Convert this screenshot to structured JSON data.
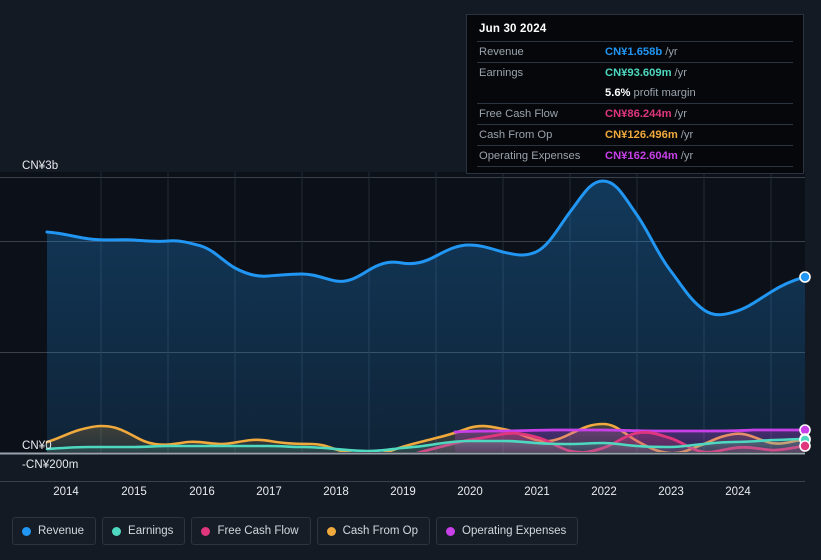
{
  "background": "#131a24",
  "axis": {
    "y_top_label": "CN¥3b",
    "y_zero_label": "CN¥0",
    "y_bottom_label": "-CN¥200m",
    "x_ticks": [
      "2014",
      "2015",
      "2016",
      "2017",
      "2018",
      "2019",
      "2020",
      "2021",
      "2022",
      "2023",
      "2024"
    ]
  },
  "tooltip": {
    "date": "Jun 30 2024",
    "rows": [
      {
        "label": "Revenue",
        "value": "CN¥1.658b",
        "unit": "/yr",
        "color": "#2196f3"
      },
      {
        "label": "Earnings",
        "value": "CN¥93.609m",
        "unit": "/yr",
        "color": "#4fd8c0"
      },
      {
        "label": "",
        "value": "5.6%",
        "sub": "profit margin",
        "color": "#ffffff"
      },
      {
        "label": "Free Cash Flow",
        "value": "CN¥86.244m",
        "unit": "/yr",
        "color": "#e0367e"
      },
      {
        "label": "Cash From Op",
        "value": "CN¥126.496m",
        "unit": "/yr",
        "color": "#f0a93c"
      },
      {
        "label": "Operating Expenses",
        "value": "CN¥162.604m",
        "unit": "/yr",
        "color": "#c740e8"
      }
    ]
  },
  "legend": [
    {
      "label": "Revenue",
      "color": "#2196f3"
    },
    {
      "label": "Earnings",
      "color": "#4fd8c0"
    },
    {
      "label": "Free Cash Flow",
      "color": "#e0367e"
    },
    {
      "label": "Cash From Op",
      "color": "#f0a93c"
    },
    {
      "label": "Operating Expenses",
      "color": "#c740e8"
    }
  ],
  "chart_data": {
    "type": "area",
    "title": "",
    "xlabel": "",
    "ylabel": "",
    "ylim": [
      -200000000,
      3000000000
    ],
    "y_gridlines": [
      "CN¥3b",
      "CN¥2b",
      "CN¥1b",
      "CN¥0",
      "-CN¥200m"
    ],
    "grid": true,
    "legend_position": "bottom",
    "currency": "CN¥",
    "x_range": [
      "2013-06",
      "2024-06"
    ],
    "x": [
      2013.5,
      2014.0,
      2014.5,
      2015.0,
      2015.5,
      2016.0,
      2016.5,
      2017.0,
      2017.5,
      2018.0,
      2018.5,
      2019.0,
      2019.5,
      2020.0,
      2020.5,
      2021.0,
      2021.5,
      2022.0,
      2022.5,
      2023.0,
      2023.5,
      2024.0,
      2024.5
    ],
    "series": [
      {
        "name": "Revenue",
        "color": "#2196f3",
        "values": [
          2070,
          2010,
          1990,
          2000,
          1980,
          1960,
          1860,
          1790,
          1800,
          1790,
          1700,
          1740,
          1830,
          1820,
          1930,
          2300,
          2830,
          2560,
          2080,
          1690,
          1520,
          1620,
          1658
        ],
        "units": "CN¥ millions",
        "end_value_label": "CN¥1.658b"
      },
      {
        "name": "Earnings",
        "color": "#4fd8c0",
        "values": [
          40,
          42,
          45,
          48,
          46,
          44,
          42,
          43,
          45,
          44,
          38,
          30,
          44,
          58,
          66,
          78,
          82,
          60,
          52,
          64,
          78,
          88,
          93.609
        ],
        "units": "CN¥ millions",
        "end_value_label": "CN¥93.609m"
      },
      {
        "name": "Free Cash Flow",
        "color": "#e0367e",
        "values": [
          null,
          null,
          null,
          null,
          null,
          null,
          null,
          null,
          null,
          null,
          null,
          -120,
          -60,
          10,
          70,
          110,
          118,
          10,
          -40,
          70,
          130,
          30,
          86.244
        ],
        "units": "CN¥ millions",
        "end_value_label": "CN¥86.244m",
        "starts_at": "2019"
      },
      {
        "name": "Cash From Op",
        "color": "#f0a93c",
        "values": [
          80,
          120,
          160,
          150,
          60,
          40,
          45,
          60,
          55,
          50,
          20,
          -30,
          30,
          80,
          140,
          160,
          165,
          60,
          0,
          120,
          180,
          70,
          126.496
        ],
        "units": "CN¥ millions",
        "end_value_label": "CN¥126.496m"
      },
      {
        "name": "Operating Expenses",
        "color": "#c740e8",
        "values": [
          null,
          null,
          null,
          null,
          null,
          null,
          null,
          null,
          null,
          null,
          null,
          null,
          null,
          150,
          152,
          155,
          158,
          156,
          154,
          152,
          155,
          160,
          162.604
        ],
        "units": "CN¥ millions",
        "end_value_label": "CN¥162.604m",
        "starts_at": "2020"
      }
    ]
  }
}
